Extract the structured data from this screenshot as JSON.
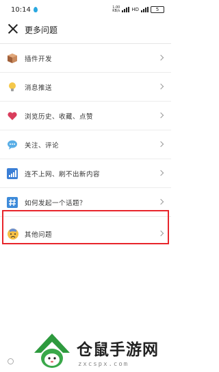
{
  "status_bar": {
    "time": "10:14",
    "net_speed": "1.00\nKB/s",
    "network": "HD",
    "battery": "5"
  },
  "header": {
    "title": "更多问题"
  },
  "list": {
    "items": [
      {
        "label": "插件开发",
        "icon": "package-box-icon",
        "color": "#b8734b"
      },
      {
        "label": "消息推送",
        "icon": "lightbulb-icon",
        "color": "#f2c14b"
      },
      {
        "label": "浏览历史、收藏、点赞",
        "icon": "heart-icon",
        "color": "#d93d5c"
      },
      {
        "label": "关注、评论",
        "icon": "speech-bubble-icon",
        "color": "#4aa3df"
      },
      {
        "label": "连不上网、刷不出新内容",
        "icon": "signal-bars-icon",
        "color": "#3b7fd6"
      },
      {
        "label": "如何发起一个话题？",
        "icon": "hashtag-icon",
        "color": "#3d8ad9"
      },
      {
        "label": "其他问题",
        "icon": "worried-face-icon",
        "color": "#f2b544"
      }
    ]
  },
  "watermark": {
    "brand": "仓鼠手游网",
    "url": "zxcspx.com"
  }
}
